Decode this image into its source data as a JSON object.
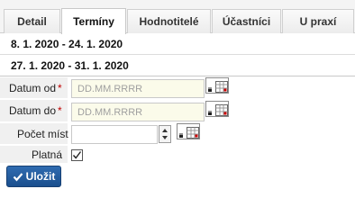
{
  "tabs": [
    {
      "label": "Detail",
      "active": false
    },
    {
      "label": "Termíny",
      "active": true
    },
    {
      "label": "Hodnotitelé",
      "active": false
    },
    {
      "label": "Účastníci",
      "active": false
    },
    {
      "label": "U praxí",
      "active": false
    }
  ],
  "date_ranges": [
    "8. 1. 2020 - 24. 1. 2020",
    "27. 1. 2020 - 31. 1. 2020"
  ],
  "form": {
    "date_from": {
      "label": "Datum od",
      "required_mark": "*",
      "placeholder": "DD.MM.RRRR",
      "value": ""
    },
    "date_to": {
      "label": "Datum do",
      "required_mark": "*",
      "placeholder": "DD.MM.RRRR",
      "value": ""
    },
    "places": {
      "label": "Počet míst",
      "value": ""
    },
    "valid": {
      "label": "Platná",
      "checked": true
    }
  },
  "save_button": {
    "label": "Uložit",
    "icon": "checkmark-icon"
  },
  "colors": {
    "primary_button": "#1f5a9c",
    "input_background": "#fbfbea",
    "required_marker": "#c00000",
    "label_cell_background": "#f0f0f0"
  }
}
